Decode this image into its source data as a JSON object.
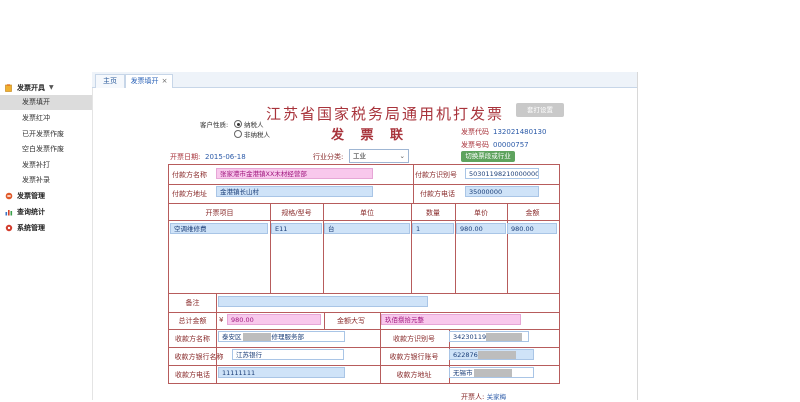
{
  "sidebar": {
    "groups": [
      {
        "label": "发票开具",
        "icon": "invoice-folder-icon",
        "items": [
          {
            "label": "发票填开",
            "active": true
          },
          {
            "label": "发票红冲"
          },
          {
            "label": "已开发票作废"
          },
          {
            "label": "空白发票作废"
          },
          {
            "label": "发票补打"
          },
          {
            "label": "发票补录"
          }
        ]
      },
      {
        "label": "发票管理",
        "icon": "invoice-manage-icon"
      },
      {
        "label": "查询统计",
        "icon": "chart-icon"
      },
      {
        "label": "系统管理",
        "icon": "settings-icon"
      }
    ]
  },
  "tabs": [
    {
      "label": "主页"
    },
    {
      "label": "发票填开",
      "active": true,
      "close": "×"
    }
  ],
  "form": {
    "title": "江苏省国家税务局通用机打发票",
    "subtitle": "发 票 联",
    "customer_type_label": "客户性质:",
    "customer_types": [
      "纳税人",
      "非纳税人"
    ],
    "print_settings_button": "套打设置",
    "invoice_code_label": "发票代码",
    "invoice_code": "132021480130",
    "invoice_number_label": "发票号码",
    "invoice_number": "00000757",
    "switch_industry_button": "切换票段或行业",
    "issue_date_label": "开票日期:",
    "issue_date": "2015-06-18",
    "industry_label": "行业分类:",
    "industry_value": "工业",
    "payer_name_label": "付款方名称",
    "payer_name": "张家港市金港镇XX木材经营部",
    "payer_tax_id_label": "付款方识别号",
    "payer_tax_id": "503011982100000000",
    "payer_address_label": "付款方地址",
    "payer_address": "金港镇长山村",
    "payer_phone_label": "付款方电话",
    "payer_phone": "35000000",
    "items_headers": [
      "开票项目",
      "规格/型号",
      "单位",
      "数量",
      "单价",
      "金额"
    ],
    "items": [
      [
        "空调维修费",
        "E11",
        "台",
        "1",
        "980.00",
        "980.00"
      ]
    ],
    "remark_label": "备注",
    "remark": "",
    "total_label": "总计金额",
    "total_symbol": "¥",
    "total_value": "980.00",
    "total_upper_label": "金额大写",
    "total_upper": "玖佰捌拾元整",
    "payee_name_label": "收款方名称",
    "payee_name_prefix": "泰安区",
    "payee_name_suffix": "修理服务部",
    "payee_tax_id_label": "收款方识别号",
    "payee_tax_id_prefix": "34230119",
    "payee_bank_label": "收款方银行名称",
    "payee_bank": "江苏银行",
    "payee_account_label": "收款方银行账号",
    "payee_account_prefix": "622876",
    "payee_phone_label": "收款方电话",
    "payee_phone": "11111111",
    "payee_address_label": "收款方地址",
    "payee_address_prefix": "无锡市",
    "drawer_label": "开票人:",
    "drawer_name": "关家梅"
  },
  "colors": {
    "accent_red": "#a8333b",
    "field_pink": "#f8c8ec",
    "field_blue": "#cfe3f8",
    "green_button": "#5ea35e"
  }
}
